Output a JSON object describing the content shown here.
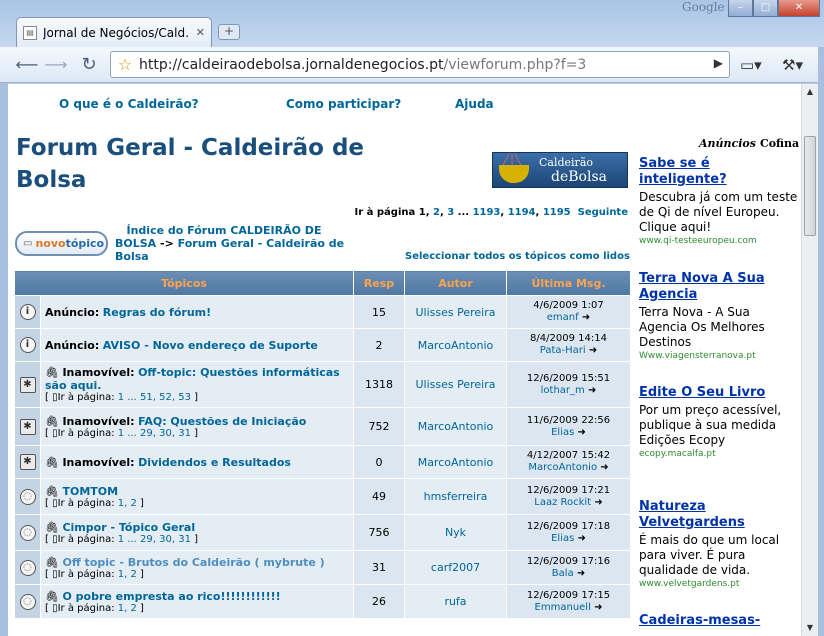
{
  "browser": {
    "tab_title": "Jornal de Negócios/Cald…",
    "google_label": "Google",
    "url_host": "http://caldeiraodebolsa.jornaldenegocios.pt",
    "url_path": "/viewforum.php?f=3"
  },
  "topnav": {
    "about": "O que é o Caldeirão?",
    "participate": "Como participar?",
    "help": "Ajuda"
  },
  "forum": {
    "title": "Forum Geral - Caldeirão de Bolsa",
    "logo_line1": "Caldeirão",
    "logo_line2": "deBolsa",
    "pagination_prefix": "Ir à página",
    "pagination_current": "1",
    "pagination_links": [
      "2",
      "3",
      "1193",
      "1194",
      "1195"
    ],
    "pagination_next": "Seguinte",
    "new_topic_a": "novo",
    "new_topic_b": "tópico",
    "breadcrumb_index": "Índice do Fórum CALDEIRÃO DE BOLSA",
    "breadcrumb_sep": "->",
    "breadcrumb_current": "Forum Geral - Caldeirão de Bolsa",
    "mark_all_read": "Seleccionar todos os tópicos como lidos"
  },
  "table": {
    "headers": {
      "topics": "Tópicos",
      "replies": "Resp",
      "author": "Autor",
      "last_msg": "Última Msg."
    },
    "rows": [
      {
        "icon": "announcement-icon",
        "glyph": "i",
        "prefix": "Anúncio:",
        "title": "Regras do fórum!",
        "pages": "",
        "replies": "15",
        "author": "Ulisses Pereira",
        "date": "4/6/2009 1:07",
        "last_by": "emanf"
      },
      {
        "icon": "announcement-icon",
        "glyph": "i",
        "prefix": "Anúncio:",
        "title": "AVISO - Novo endereço de Suporte",
        "pages": "",
        "replies": "2",
        "author": "MarcoAntonio",
        "date": "8/4/2009 14:14",
        "last_by": "Pata-Hari"
      },
      {
        "icon": "sticky-icon",
        "glyph": "✱",
        "prefix": "Inamovível:",
        "title": "Off-topic: Questões informáticas são aqui.",
        "pages": "1 ... 51, 52, 53",
        "replies": "1318",
        "author": "Ulisses Pereira",
        "date": "12/6/2009 15:51",
        "last_by": "lothar_m"
      },
      {
        "icon": "sticky-icon",
        "glyph": "✱",
        "prefix": "Inamovível:",
        "title": "FAQ: Questões de Iniciação",
        "pages": "1 ... 29, 30, 31",
        "replies": "752",
        "author": "MarcoAntonio",
        "date": "11/6/2009 22:56",
        "last_by": "Elias"
      },
      {
        "icon": "sticky-icon",
        "glyph": "✱",
        "prefix": "Inamovível:",
        "title": "Dividendos e Resultados",
        "pages": "",
        "replies": "0",
        "author": "MarcoAntonio",
        "date": "4/12/2007 15:42",
        "last_by": "MarcoAntonio"
      },
      {
        "icon": "topic-icon",
        "glyph": "◌",
        "prefix": "",
        "title": "TOMTOM",
        "pages": "1, 2",
        "replies": "49",
        "author": "hmsferreira",
        "date": "12/6/2009 17:21",
        "last_by": "Laaz Rockit"
      },
      {
        "icon": "topic-icon",
        "glyph": "◌",
        "prefix": "",
        "title": "Cimpor - Tópico Geral",
        "pages": "1 ... 29, 30, 31",
        "replies": "756",
        "author": "Nyk",
        "date": "12/6/2009 17:18",
        "last_by": "Elias"
      },
      {
        "icon": "topic-icon",
        "glyph": "◌",
        "prefix": "",
        "title": "Off topic - Brutos do Caldeirão ( mybrute )",
        "pages": "1, 2",
        "replies": "31",
        "author": "carf2007",
        "date": "12/6/2009 17:16",
        "last_by": "Bala"
      },
      {
        "icon": "topic-icon",
        "glyph": "◌",
        "prefix": "",
        "title": "O pobre empresta ao rico!!!!!!!!!!!!",
        "pages": "1, 2",
        "replies": "26",
        "author": "rufa",
        "date": "12/6/2009 17:15",
        "last_by": "Emmanuell"
      }
    ],
    "pages_prefix": "Ir à página:"
  },
  "ads": {
    "header": "Anúncios",
    "brand": "Cofina",
    "items": [
      {
        "title": "Sabe se é inteligente?",
        "body": "Descubra já com um teste de Qi de nível Europeu. Clique aqui!",
        "url": "www.qi-testeeuropeu.com"
      },
      {
        "title": "Terra Nova A Sua Agencia",
        "body": "Terra Nova - A Sua Agencia Os Melhores Destinos",
        "url": "Www.viagensterranova.pt"
      },
      {
        "title": "Edite O Seu Livro",
        "body": "Por um preço acessível, publique à sua medida Edições Ecopy",
        "url": "ecopy.macalfa.pt"
      },
      {
        "title": "Natureza Velvetgardens",
        "body": "É mais do que um local para viver. É pura qualidade de vida.",
        "url": "www.velvetgardens.pt"
      },
      {
        "title": "Cadeiras-mesas-",
        "body": "",
        "url": ""
      }
    ]
  }
}
